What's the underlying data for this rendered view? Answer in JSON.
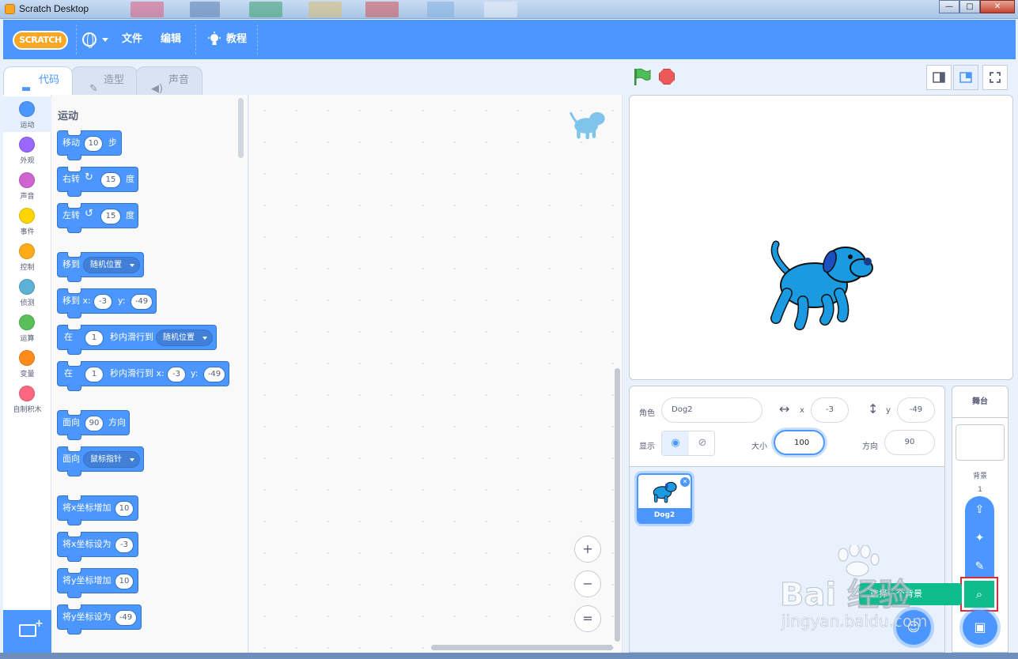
{
  "window": {
    "title": "Scratch Desktop",
    "controls": [
      "—",
      "□",
      "✕"
    ]
  },
  "menubar": {
    "logo": "SCRATCH",
    "file": "文件",
    "edit": "编辑",
    "tutorials": "教程"
  },
  "tabs": {
    "code": "代码",
    "costumes": "造型",
    "sounds": "声音"
  },
  "categories": [
    {
      "label": "运动",
      "color": "#4c97ff"
    },
    {
      "label": "外观",
      "color": "#9966ff"
    },
    {
      "label": "声音",
      "color": "#cf63cf"
    },
    {
      "label": "事件",
      "color": "#ffd500"
    },
    {
      "label": "控制",
      "color": "#ffab19"
    },
    {
      "label": "侦测",
      "color": "#5cb1d6"
    },
    {
      "label": "运算",
      "color": "#59c059"
    },
    {
      "label": "变量",
      "color": "#ff8c1a"
    },
    {
      "label": "自制积木",
      "color": "#ff6680"
    }
  ],
  "palette": {
    "heading": "运动",
    "move": {
      "a": "移动",
      "v": "10",
      "b": "步"
    },
    "turn_right": {
      "a": "右转",
      "v": "15",
      "b": "度"
    },
    "turn_left": {
      "a": "左转",
      "v": "15",
      "b": "度"
    },
    "goto": {
      "a": "移到",
      "d": "随机位置"
    },
    "goto_xy": {
      "a": "移到 x:",
      "x": "-3",
      "b": "y:",
      "y": "-49"
    },
    "glide": {
      "a": "在",
      "v": "1",
      "b": "秒内滑行到",
      "d": "随机位置"
    },
    "glide_xy": {
      "a": "在",
      "v": "1",
      "b": "秒内滑行到 x:",
      "x": "-3",
      "c": "y:",
      "y": "-49"
    },
    "point_dir": {
      "a": "面向",
      "v": "90",
      "b": "方向"
    },
    "point_towards": {
      "a": "面向",
      "d": "鼠标指针"
    },
    "change_x": {
      "a": "将x坐标增加",
      "v": "10"
    },
    "set_x": {
      "a": "将x坐标设为",
      "v": "-3"
    },
    "change_y": {
      "a": "将y坐标增加",
      "v": "10"
    },
    "set_y": {
      "a": "将y坐标设为",
      "v": "-49"
    }
  },
  "code_area": {
    "zoom_in": "+",
    "zoom_out": "−",
    "zoom_reset": "="
  },
  "sprite_info": {
    "sprite_label": "角色",
    "sprite_name": "Dog2",
    "x_label": "x",
    "x": "-3",
    "y_label": "y",
    "y": "-49",
    "show_label": "显示",
    "size_label": "大小",
    "size": "100",
    "direction_label": "方向",
    "direction": "90"
  },
  "sprites": [
    {
      "name": "Dog2",
      "delete": "✕"
    }
  ],
  "stage_selector": {
    "title": "舞台",
    "backdrops_label": "背景",
    "backdrops_count": "1"
  },
  "tooltip": "选择一个背景",
  "watermark": {
    "text": "Bai 经验",
    "url": "jingyan.baidu.com"
  },
  "colors": {
    "motion": "#4c97ff",
    "accent_green": "#0fbd8c",
    "menubar": "#4c97ff",
    "highlight_box": "#d0303a"
  }
}
